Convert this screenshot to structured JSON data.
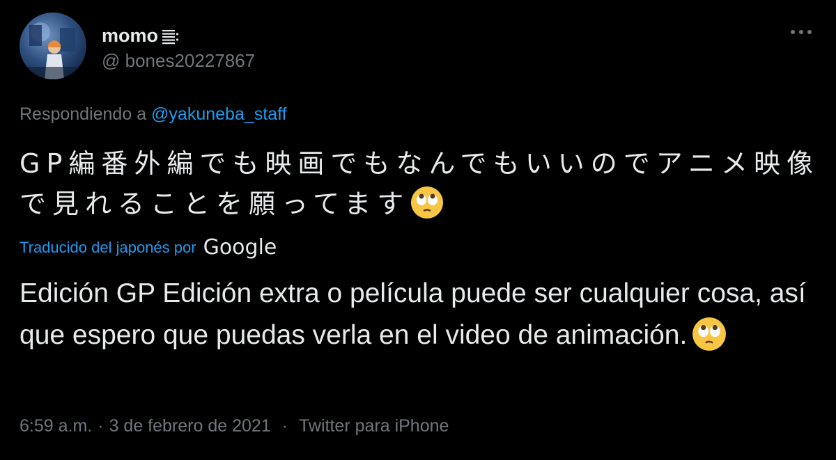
{
  "tweet": {
    "display_name": "momo",
    "name_icon": "hotspring-icon",
    "handle": "@ bones20227867",
    "more_icon": "more-dots-icon",
    "replying_prefix": "Respondiendo a ",
    "replying_mention": "@yakuneba_staff",
    "original_text": "GP編番外編でも映画でもなんでもいいのでアニメ映像で見れることを願ってます",
    "emoji": "face-with-rolling-eyes",
    "translated_label": "Traducido del japonés por",
    "translation_provider": "Google",
    "translated_text": "Edición GP Edición extra o película puede ser cualquier cosa, así que espero que puedas verla en el video de animación.",
    "time": "6:59 a.m.",
    "date": "3 de febrero de 2021",
    "separator": "·",
    "source": "Twitter para iPhone"
  },
  "colors": {
    "background": "#000000",
    "text": "#e7e9ea",
    "secondary": "#71767b",
    "accent": "#1d9bf0"
  }
}
